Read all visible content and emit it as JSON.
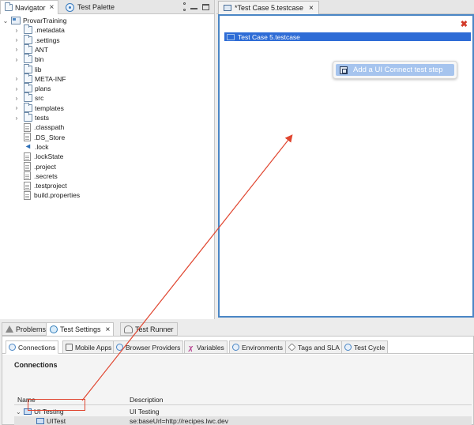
{
  "navigator": {
    "tabs": [
      {
        "label": "Navigator",
        "close": "×"
      },
      {
        "label": "Test Palette"
      }
    ],
    "tree": [
      {
        "label": "ProvarTraining",
        "kind": "project",
        "expanded": true
      },
      {
        "label": ".metadata",
        "kind": "folder"
      },
      {
        "label": ".settings",
        "kind": "folder"
      },
      {
        "label": "ANT",
        "kind": "folder"
      },
      {
        "label": "bin",
        "kind": "folder"
      },
      {
        "label": "lib",
        "kind": "folder"
      },
      {
        "label": "META-INF",
        "kind": "folder"
      },
      {
        "label": "plans",
        "kind": "folder"
      },
      {
        "label": "src",
        "kind": "folder"
      },
      {
        "label": "templates",
        "kind": "folder"
      },
      {
        "label": "tests",
        "kind": "folder"
      },
      {
        "label": ".classpath",
        "kind": "file"
      },
      {
        "label": ".DS_Store",
        "kind": "file"
      },
      {
        "label": ".lock",
        "kind": "lock"
      },
      {
        "label": ".lockState",
        "kind": "file"
      },
      {
        "label": ".project",
        "kind": "file"
      },
      {
        "label": ".secrets",
        "kind": "file"
      },
      {
        "label": ".testproject",
        "kind": "file"
      },
      {
        "label": "build.properties",
        "kind": "file"
      }
    ]
  },
  "editor": {
    "tab_label": "*Test Case 5.testcase",
    "tab_close": "×",
    "close_glyph": "✖",
    "root_node": "Test Case 5.testcase",
    "add_step_label": "Add a UI Connect test step"
  },
  "bottom": {
    "view_tabs": [
      {
        "label": "Problems"
      },
      {
        "label": "Test Settings",
        "close": "×"
      },
      {
        "label": "Test Runner"
      }
    ],
    "sub_tabs": [
      "Connections",
      "Mobile Apps",
      "Browser Providers",
      "Variables",
      "Environments",
      "Tags and SLA",
      "Test Cycle"
    ],
    "variables_glyph": "χ",
    "section_title": "Connections",
    "columns": {
      "name": "Name",
      "description": "Description"
    },
    "rows": [
      {
        "name": "UI Testing",
        "description": "UI Testing"
      },
      {
        "name": "UITest",
        "description": "se:baseUrl=http://recipes.lwc.dev"
      }
    ]
  },
  "colors": {
    "annotation": "#e0452f",
    "selection": "#2e6cd6",
    "button": "#a6c4ee",
    "editor_border": "#4a86c5"
  }
}
